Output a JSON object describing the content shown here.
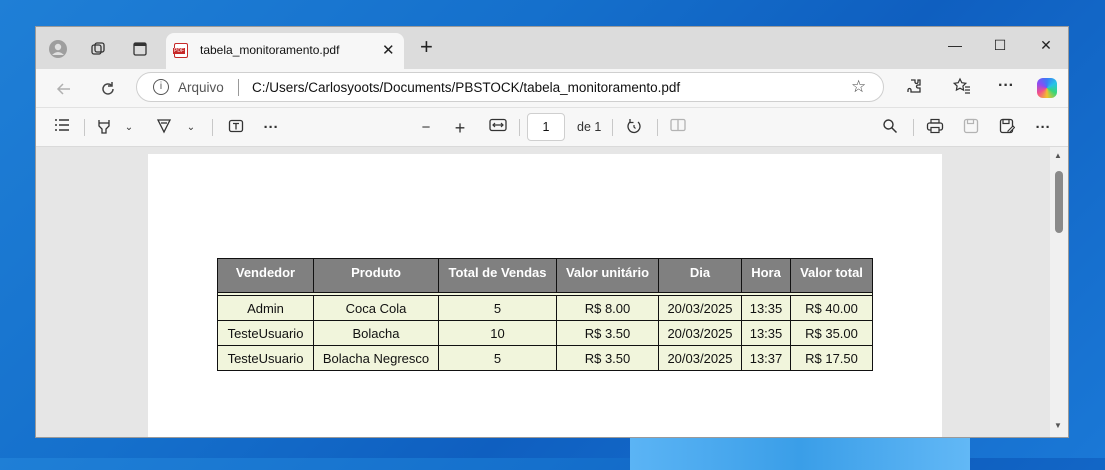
{
  "browser": {
    "tab": {
      "title": "tabela_monitoramento.pdf",
      "close_glyph": "✕"
    },
    "new_tab_glyph": "+",
    "window_controls": {
      "minimize": "—",
      "maximize": "☐",
      "close": "✕"
    },
    "address": {
      "scheme_label": "Arquivo",
      "url": "C:/Users/Carlosyoots/Documents/PBSTOCK/tabela_monitoramento.pdf"
    }
  },
  "pdf_toolbar": {
    "page_current": "1",
    "page_of": "de 1"
  },
  "table": {
    "headers": [
      "Vendedor",
      "Produto",
      "Total de Vendas",
      "Valor unitário",
      "Dia",
      "Hora",
      "Valor total"
    ],
    "rows": [
      [
        "Admin",
        "Coca Cola",
        "5",
        "R$ 8.00",
        "20/03/2025",
        "13:35",
        "R$ 40.00"
      ],
      [
        "TesteUsuario",
        "Bolacha",
        "10",
        "R$ 3.50",
        "20/03/2025",
        "13:35",
        "R$ 35.00"
      ],
      [
        "TesteUsuario",
        "Bolacha Negresco",
        "5",
        "R$ 3.50",
        "20/03/2025",
        "13:37",
        "R$ 17.50"
      ]
    ]
  },
  "colors": {
    "header_bg": "#808080",
    "cell_bg": "#f1f5dc",
    "accent_pdf": "#c62828"
  },
  "icons": [
    "profile-icon",
    "workspaces-icon",
    "tab-actions-icon",
    "pdf-file-icon",
    "back-icon",
    "refresh-icon",
    "info-icon",
    "favorite-star-icon",
    "extensions-icon",
    "favorites-icon",
    "more-icon",
    "copilot-icon",
    "contents-icon",
    "highlight-icon",
    "draw-icon",
    "text-icon",
    "zoom-out-icon",
    "zoom-in-icon",
    "fit-page-icon",
    "rotate-icon",
    "two-page-icon",
    "search-icon",
    "print-icon",
    "save-icon",
    "save-as-icon"
  ]
}
